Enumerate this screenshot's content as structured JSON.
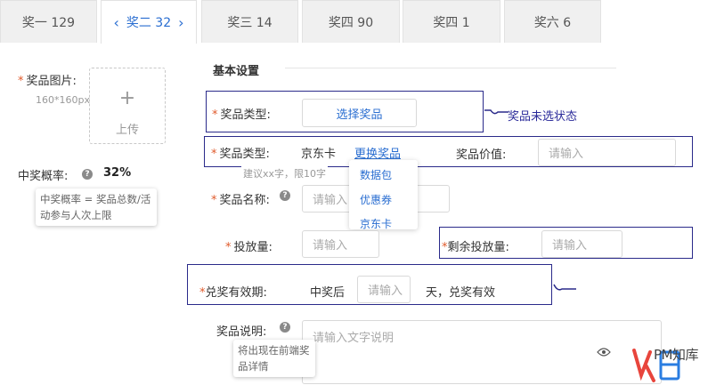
{
  "tabs": [
    {
      "label": "奖一  129",
      "active": false
    },
    {
      "label": "奖二  32",
      "active": true
    },
    {
      "label": "奖三 14",
      "active": false
    },
    {
      "label": "奖四 90",
      "active": false
    },
    {
      "label": "奖四 1",
      "active": false
    },
    {
      "label": "奖六 6",
      "active": false
    }
  ],
  "left": {
    "image_label": "奖品图片:",
    "image_hint": "160*160px",
    "upload_plus": "+",
    "upload_label": "上传",
    "prob_label": "中奖概率:",
    "prob_value": "32%",
    "prob_tooltip": "中奖概率 = 奖品总数/活动参与人次上限"
  },
  "section_title": "基本设置",
  "form": {
    "type_label": "奖品类型:",
    "select_prize_button": "选择奖品",
    "annotation_unselected": "奖品未选状态",
    "type_label2": "奖品类型:",
    "type_value": "京东卡",
    "change_prize_link": "更换奖品",
    "prize_value_label": "奖品价值:",
    "prize_value_placeholder": "请输入",
    "hint_text": "建议xx字，限10字",
    "dropdown_items": [
      "数据包",
      "优惠券",
      "京东卡"
    ],
    "name_label": "奖品名称:",
    "name_placeholder": "请输入",
    "qty_label": "投放量:",
    "qty_placeholder": "请输入",
    "remaining_label": "剩余投放量:",
    "remaining_placeholder": "请输入",
    "validity_label": "兑奖有效期:",
    "validity_prefix": "中奖后",
    "validity_placeholder": "请输入",
    "validity_suffix": "天，兑奖有效",
    "desc_label": "奖品说明:",
    "desc_placeholder": "请输入文字说明",
    "desc_tooltip": "将出现在前端奖品详情"
  },
  "watermark": {
    "text": "PM知库"
  },
  "colors": {
    "accent": "#2a6ed1",
    "required": "#e05a2b",
    "annotation": "#2a2a8a"
  }
}
